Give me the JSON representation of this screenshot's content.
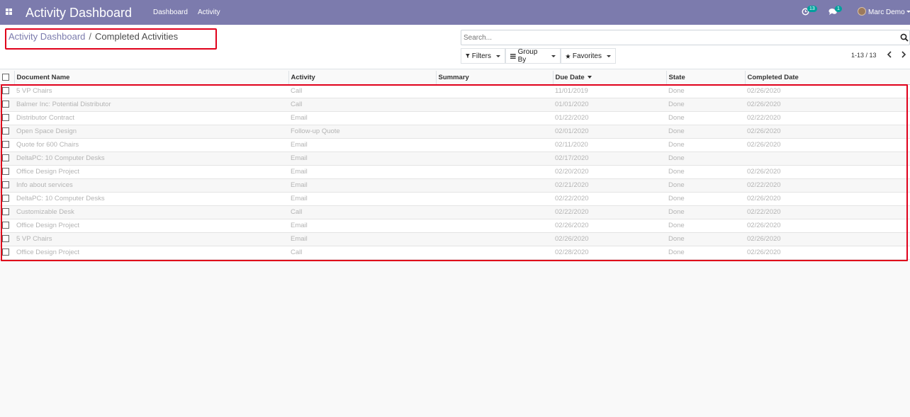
{
  "navbar": {
    "brand": "Activity Dashboard",
    "menu": [
      "Dashboard",
      "Activity"
    ],
    "activity_count": "13",
    "message_count": "1",
    "user_name": "Marc Demo"
  },
  "breadcrumb": {
    "parent": "Activity Dashboard",
    "separator": "/",
    "current": "Completed Activities"
  },
  "search": {
    "placeholder": "Search..."
  },
  "search_options": {
    "filters": "Filters",
    "group_by": "Group By",
    "favorites": "Favorites"
  },
  "pager": {
    "value": "1-13 / 13"
  },
  "table": {
    "headers": {
      "document": "Document Name",
      "activity": "Activity",
      "summary": "Summary",
      "due_date": "Due Date",
      "state": "State",
      "completed": "Completed Date"
    },
    "rows": [
      {
        "document": "5 VP Chairs",
        "activity": "Call",
        "summary": "",
        "due_date": "11/01/2019",
        "state": "Done",
        "completed": "02/26/2020"
      },
      {
        "document": "Balmer Inc: Potential Distributor",
        "activity": "Call",
        "summary": "",
        "due_date": "01/01/2020",
        "state": "Done",
        "completed": "02/26/2020"
      },
      {
        "document": "Distributor Contract",
        "activity": "Email",
        "summary": "",
        "due_date": "01/22/2020",
        "state": "Done",
        "completed": "02/22/2020"
      },
      {
        "document": "Open Space Design",
        "activity": "Follow-up Quote",
        "summary": "",
        "due_date": "02/01/2020",
        "state": "Done",
        "completed": "02/26/2020"
      },
      {
        "document": "Quote for 600 Chairs",
        "activity": "Email",
        "summary": "",
        "due_date": "02/11/2020",
        "state": "Done",
        "completed": "02/26/2020"
      },
      {
        "document": "DeltaPC: 10 Computer Desks",
        "activity": "Email",
        "summary": "",
        "due_date": "02/17/2020",
        "state": "Done",
        "completed": ""
      },
      {
        "document": "Office Design Project",
        "activity": "Email",
        "summary": "",
        "due_date": "02/20/2020",
        "state": "Done",
        "completed": "02/26/2020"
      },
      {
        "document": "Info about services",
        "activity": "Email",
        "summary": "",
        "due_date": "02/21/2020",
        "state": "Done",
        "completed": "02/22/2020"
      },
      {
        "document": "DeltaPC: 10 Computer Desks",
        "activity": "Email",
        "summary": "",
        "due_date": "02/22/2020",
        "state": "Done",
        "completed": "02/26/2020"
      },
      {
        "document": "Customizable Desk",
        "activity": "Call",
        "summary": "",
        "due_date": "02/22/2020",
        "state": "Done",
        "completed": "02/22/2020"
      },
      {
        "document": "Office Design Project",
        "activity": "Email",
        "summary": "",
        "due_date": "02/26/2020",
        "state": "Done",
        "completed": "02/26/2020"
      },
      {
        "document": "5 VP Chairs",
        "activity": "Email",
        "summary": "",
        "due_date": "02/26/2020",
        "state": "Done",
        "completed": "02/26/2020"
      },
      {
        "document": "Office Design Project",
        "activity": "Call",
        "summary": "",
        "due_date": "02/28/2020",
        "state": "Done",
        "completed": "02/26/2020"
      }
    ]
  },
  "colors": {
    "navbar": "#7c7bad",
    "highlight": "#e0001b",
    "badge": "#00a09d"
  }
}
